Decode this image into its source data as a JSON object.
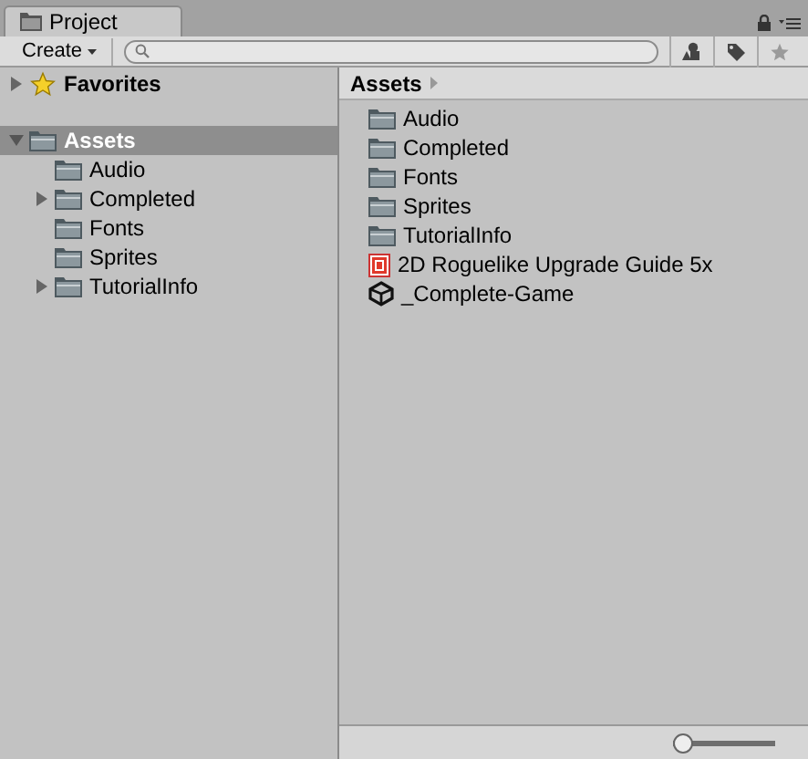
{
  "tab": {
    "title": "Project"
  },
  "toolbar": {
    "create_button": "Create"
  },
  "tree": [
    {
      "label": "Favorites",
      "kind": "favorites",
      "expanded": false,
      "selected": false
    },
    {
      "label": "Assets",
      "kind": "folder",
      "expanded": true,
      "selected": true,
      "children": [
        {
          "label": "Audio",
          "kind": "folder",
          "selected": false
        },
        {
          "label": "Completed",
          "kind": "folder",
          "expanded": false,
          "selected": false
        },
        {
          "label": "Fonts",
          "kind": "folder",
          "selected": false
        },
        {
          "label": "Sprites",
          "kind": "folder",
          "selected": false
        },
        {
          "label": "TutorialInfo",
          "kind": "folder",
          "expanded": false,
          "selected": false
        }
      ]
    }
  ],
  "breadcrumb": {
    "label": "Assets"
  },
  "files": [
    {
      "label": "Audio",
      "kind": "folder"
    },
    {
      "label": "Completed",
      "kind": "folder"
    },
    {
      "label": "Fonts",
      "kind": "folder"
    },
    {
      "label": "Sprites",
      "kind": "folder"
    },
    {
      "label": "TutorialInfo",
      "kind": "folder"
    },
    {
      "label": "2D Roguelike Upgrade Guide 5x",
      "kind": "pdf"
    },
    {
      "label": "_Complete-Game",
      "kind": "scene"
    }
  ],
  "zoom_slider": {
    "level": 0
  }
}
